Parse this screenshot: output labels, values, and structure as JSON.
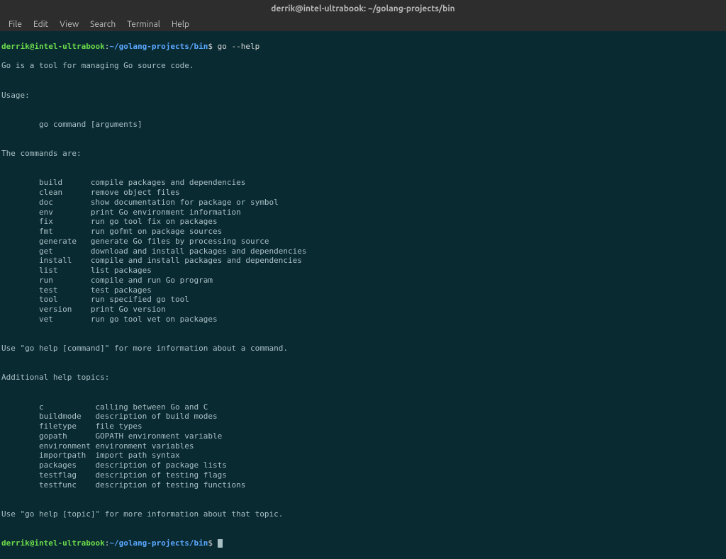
{
  "window": {
    "title": "derrik@intel-ultrabook: ~/golang-projects/bin"
  },
  "menubar": [
    "File",
    "Edit",
    "View",
    "Search",
    "Terminal",
    "Help"
  ],
  "prompt": {
    "user": "derrik@intel-ultrabook",
    "sep1": ":",
    "path": "~/golang-projects/bin",
    "dollar": "$"
  },
  "session": {
    "command": "go --help",
    "intro": "Go is a tool for managing Go source code.",
    "usage_label": "Usage:",
    "usage_line": "go command [arguments]",
    "commands_header": "The commands are:",
    "commands": [
      {
        "name": "build",
        "desc": "compile packages and dependencies"
      },
      {
        "name": "clean",
        "desc": "remove object files"
      },
      {
        "name": "doc",
        "desc": "show documentation for package or symbol"
      },
      {
        "name": "env",
        "desc": "print Go environment information"
      },
      {
        "name": "fix",
        "desc": "run go tool fix on packages"
      },
      {
        "name": "fmt",
        "desc": "run gofmt on package sources"
      },
      {
        "name": "generate",
        "desc": "generate Go files by processing source"
      },
      {
        "name": "get",
        "desc": "download and install packages and dependencies"
      },
      {
        "name": "install",
        "desc": "compile and install packages and dependencies"
      },
      {
        "name": "list",
        "desc": "list packages"
      },
      {
        "name": "run",
        "desc": "compile and run Go program"
      },
      {
        "name": "test",
        "desc": "test packages"
      },
      {
        "name": "tool",
        "desc": "run specified go tool"
      },
      {
        "name": "version",
        "desc": "print Go version"
      },
      {
        "name": "vet",
        "desc": "run go tool vet on packages"
      }
    ],
    "help_cmd_hint": "Use \"go help [command]\" for more information about a command.",
    "topics_header": "Additional help topics:",
    "topics": [
      {
        "name": "c",
        "desc": "calling between Go and C"
      },
      {
        "name": "buildmode",
        "desc": "description of build modes"
      },
      {
        "name": "filetype",
        "desc": "file types"
      },
      {
        "name": "gopath",
        "desc": "GOPATH environment variable"
      },
      {
        "name": "environment",
        "desc": "environment variables"
      },
      {
        "name": "importpath",
        "desc": "import path syntax"
      },
      {
        "name": "packages",
        "desc": "description of package lists"
      },
      {
        "name": "testflag",
        "desc": "description of testing flags"
      },
      {
        "name": "testfunc",
        "desc": "description of testing functions"
      }
    ],
    "help_topic_hint": "Use \"go help [topic]\" for more information about that topic."
  }
}
